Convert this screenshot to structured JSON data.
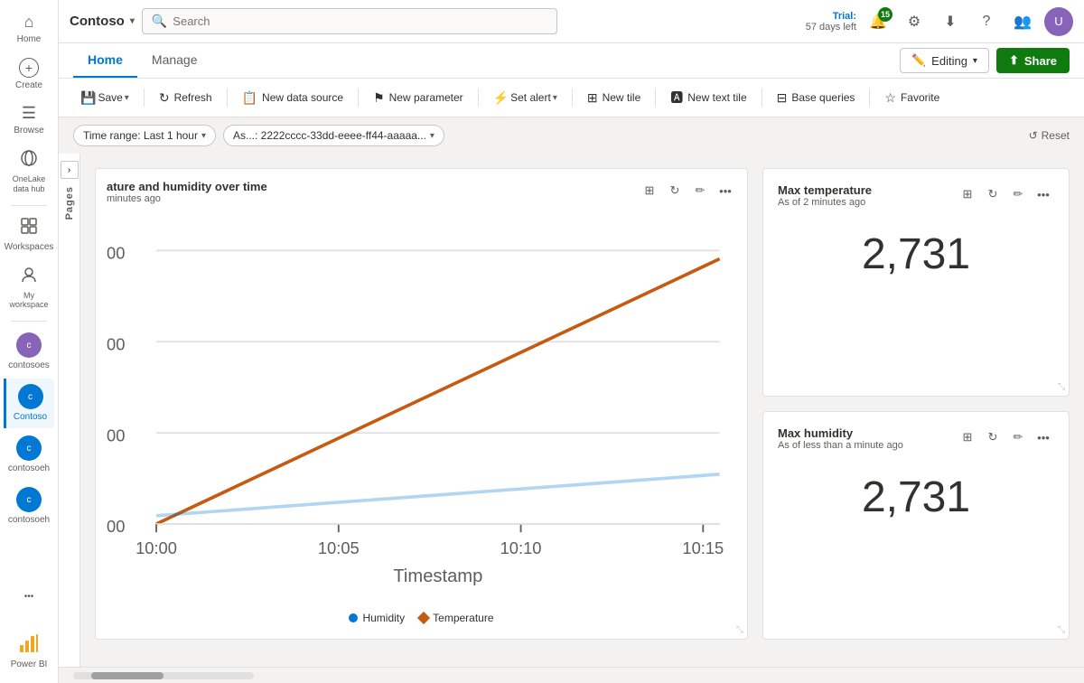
{
  "topbar": {
    "app_name": "Contoso",
    "search_placeholder": "Search",
    "trial_label": "Trial:",
    "trial_days": "57 days left",
    "notif_count": "15"
  },
  "tabs": {
    "home": "Home",
    "manage": "Manage",
    "editing_label": "Editing",
    "share_label": "Share"
  },
  "toolbar": {
    "save": "Save",
    "refresh": "Refresh",
    "new_data_source": "New data source",
    "new_parameter": "New parameter",
    "set_alert": "Set alert",
    "new_tile": "New tile",
    "new_text_tile": "New text tile",
    "base_queries": "Base queries",
    "favorite": "Favorite"
  },
  "filters": {
    "time_range": "Time range: Last 1 hour",
    "asset": "As...: 2222cccc-33dd-eeee-ff44-aaaaa...",
    "reset": "Reset"
  },
  "pages_label": "Pages",
  "chart": {
    "title": "ature and humidity over time",
    "subtitle": "minutes ago",
    "x_label": "Timestamp",
    "x_ticks": [
      "10:00",
      "10:05",
      "10:10",
      "10:15"
    ],
    "legend": [
      {
        "label": "Humidity",
        "color": "#0078d4"
      },
      {
        "label": "Temperature",
        "color": "#c55a11"
      }
    ]
  },
  "kpi1": {
    "title": "Max temperature",
    "subtitle": "As of 2 minutes ago",
    "value": "2,731"
  },
  "kpi2": {
    "title": "Max humidity",
    "subtitle": "As of less than a minute ago",
    "value": "2,731"
  },
  "sidebar": {
    "items": [
      {
        "id": "home",
        "label": "Home",
        "icon": "⌂"
      },
      {
        "id": "create",
        "label": "Create",
        "icon": "+"
      },
      {
        "id": "browse",
        "label": "Browse",
        "icon": "☰"
      },
      {
        "id": "onelake",
        "label": "OneLake data hub",
        "icon": "◈"
      },
      {
        "id": "workspaces",
        "label": "Workspaces",
        "icon": "⊞"
      },
      {
        "id": "my-workspace",
        "label": "My workspace",
        "icon": "⊙"
      },
      {
        "id": "contosoes",
        "label": "contosoes",
        "icon": "👤"
      },
      {
        "id": "contoso",
        "label": "Contoso",
        "icon": "👤"
      },
      {
        "id": "contosoeh",
        "label": "contosoeh",
        "icon": "👤"
      },
      {
        "id": "contosoeh2",
        "label": "contosoeh",
        "icon": "👤"
      }
    ]
  },
  "colors": {
    "active_nav": "#0078d4",
    "share_btn_bg": "#0f7b0f",
    "temperature_line": "#c55a11",
    "humidity_dot": "#0078d4"
  }
}
